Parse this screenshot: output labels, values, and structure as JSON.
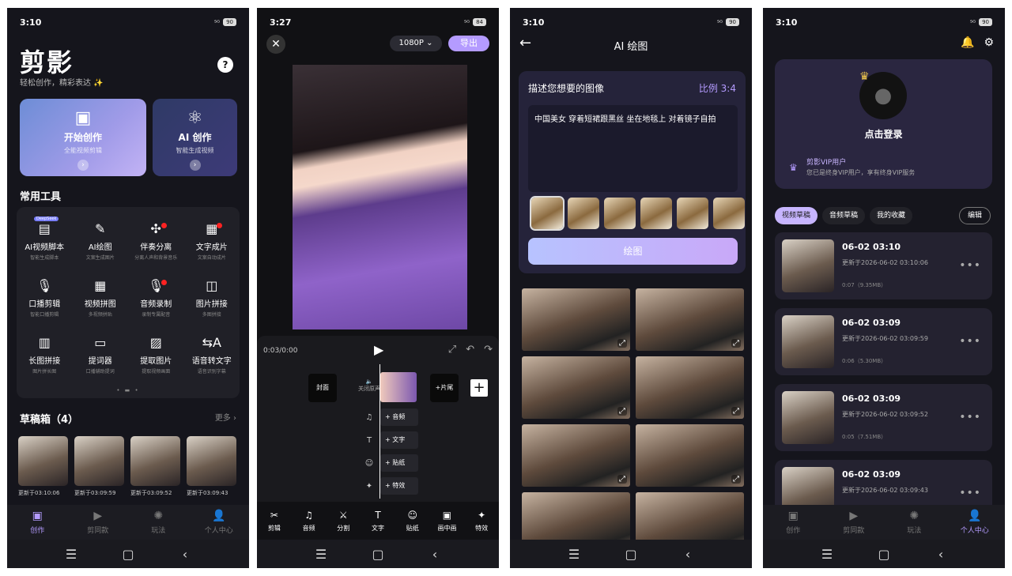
{
  "colors": {
    "accent": "#b49bff",
    "background": "#15151c"
  },
  "status": {
    "s1_time": "3:10",
    "s2_time": "3:27",
    "s3_time": "3:10",
    "s4_time": "3:10",
    "signal": "⁵ᴳ",
    "batt_s1": "90",
    "batt_s2": "84",
    "batt_s3": "90",
    "batt_s4": "90"
  },
  "sysnav": {
    "menu": "☰",
    "home": "▢",
    "back": "‹"
  },
  "tabs": [
    {
      "label": "创作",
      "icon": "▣"
    },
    {
      "label": "剪同款",
      "icon": "▶"
    },
    {
      "label": "玩法",
      "icon": "✺"
    },
    {
      "label": "个人中心",
      "icon": "👤"
    }
  ],
  "home": {
    "logo": "剪影",
    "slogan": "轻松创作，精彩表达 ✨",
    "help_icon": "?",
    "start": {
      "title": "开始创作",
      "sub": "全能视频剪辑",
      "icon": "▣",
      "arrow": "›"
    },
    "ai": {
      "title": "AI 创作",
      "sub": "智能生成视频",
      "icon": "⚛",
      "arrow": "›"
    },
    "tools_title": "常用工具",
    "tools": [
      {
        "label": "AI视频脚本",
        "sub": "智能生成脚本",
        "icon": "▤",
        "badge": "DeepSeek"
      },
      {
        "label": "AI绘图",
        "sub": "文案生成图片",
        "icon": "✎"
      },
      {
        "label": "伴奏分离",
        "sub": "分离人声和背景音乐",
        "icon": "✣",
        "dot": true
      },
      {
        "label": "文字成片",
        "sub": "文案自动成片",
        "icon": "▦",
        "dot": true
      },
      {
        "label": "口播剪辑",
        "sub": "智能口播剪辑",
        "icon": "🎙"
      },
      {
        "label": "视频拼图",
        "sub": "多视频拼贴",
        "icon": "▦"
      },
      {
        "label": "音频录制",
        "sub": "录制专属配音",
        "icon": "🎙",
        "dot": true
      },
      {
        "label": "图片拼接",
        "sub": "多图拼接",
        "icon": "◫"
      },
      {
        "label": "长图拼接",
        "sub": "图片拼长图",
        "icon": "▥"
      },
      {
        "label": "提词器",
        "sub": "口播辅助提词",
        "icon": "▭"
      },
      {
        "label": "提取图片",
        "sub": "提取视频画面",
        "icon": "▨"
      },
      {
        "label": "语音转文字",
        "sub": "语音识别字幕",
        "icon": "⇆A"
      }
    ],
    "pager": "• ▬ •",
    "drafts_title": "草稿箱（4）",
    "drafts_more": "更多 ›",
    "drafts": [
      {
        "date": "更新于03:10:06"
      },
      {
        "date": "更新于03:09:59"
      },
      {
        "date": "更新于03:09:52"
      },
      {
        "date": "更新于03:09:43"
      }
    ]
  },
  "editor": {
    "close": "✕",
    "resolution": "1080P ⌄",
    "export": "导出",
    "time": "0:03/0:00",
    "play": "▶",
    "fullscreen": "⤢",
    "undo": "↶",
    "redo": "↷",
    "cover": "封面",
    "mute": "🔈\n关闭原声",
    "tail": "+片尾",
    "add": "+",
    "tracks": [
      {
        "icon": "♫",
        "label": "+ 音频"
      },
      {
        "icon": "T",
        "label": "+ 文字"
      },
      {
        "icon": "☺",
        "label": "+ 贴纸"
      },
      {
        "icon": "✦",
        "label": "+ 特效"
      }
    ],
    "toolbar": [
      {
        "icon": "✂",
        "label": "剪辑"
      },
      {
        "icon": "♫",
        "label": "音频"
      },
      {
        "icon": "⚔",
        "label": "分割"
      },
      {
        "icon": "T",
        "label": "文字"
      },
      {
        "icon": "☺",
        "label": "贴纸"
      },
      {
        "icon": "▣",
        "label": "画中画"
      },
      {
        "icon": "✦",
        "label": "特效"
      }
    ]
  },
  "aidraw": {
    "back": "←",
    "title": "AI 绘图",
    "prompt_title": "描述您想要的图像",
    "ratio": "比例 3:4",
    "prompt": "中国美女 穿着短裙跟黑丝 坐在地毯上 对着镜子自拍",
    "draw": "绘图",
    "expand": "⤢"
  },
  "profile": {
    "bell": "🔔",
    "gear": "⚙",
    "crown": "♛",
    "avatar": "●",
    "login": "点击登录",
    "vip_icon": "♛",
    "vip_title": "剪影VIP用户",
    "vip_sub": "您已是终身VIP用户，享有终身VIP服务",
    "tabs": [
      "视频草稿",
      "音频草稿",
      "我的收藏"
    ],
    "edit": "编辑",
    "projects": [
      {
        "title": "06-02 03:10",
        "updated": "更新于2026-06-02 03:10:06",
        "size": "0:07（9.35MB）"
      },
      {
        "title": "06-02 03:09",
        "updated": "更新于2026-06-02 03:09:59",
        "size": "0:06（5.30MB）"
      },
      {
        "title": "06-02 03:09",
        "updated": "更新于2026-06-02 03:09:52",
        "size": "0:05（7.51MB）"
      },
      {
        "title": "06-02 03:09",
        "updated": "更新于2026-06-02 03:09:43",
        "size": ""
      }
    ],
    "more": "•••"
  }
}
